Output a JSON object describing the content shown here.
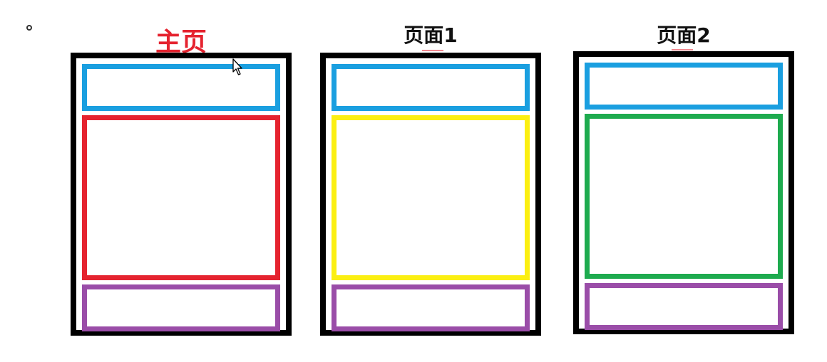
{
  "pages": [
    {
      "title": "主页",
      "content_color": "#e5232f",
      "header_color": "#1a9fe0",
      "footer_color": "#9a4da8"
    },
    {
      "title": "页面1",
      "content_color": "#fbef12",
      "header_color": "#1a9fe0",
      "footer_color": "#9a4da8"
    },
    {
      "title": "页面2",
      "content_color": "#1eab4f",
      "header_color": "#1a9fe0",
      "footer_color": "#9a4da8"
    }
  ],
  "icons": {
    "bullet": "hollow-circle",
    "cursor": "mouse-pointer"
  }
}
